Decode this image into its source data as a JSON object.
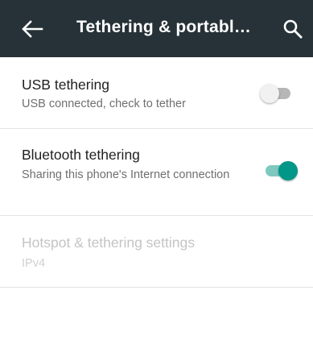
{
  "appbar": {
    "back_icon": "arrow-back-icon",
    "title": "Tethering & portabl…",
    "search_icon": "search-icon",
    "background_color": "#263238"
  },
  "settings": [
    {
      "title": "USB tethering",
      "summary": "USB connected, check to tether",
      "switch_on": false,
      "enabled": true
    },
    {
      "title": "Bluetooth tethering",
      "summary": "Sharing this phone's Internet connection",
      "switch_on": true,
      "enabled": true
    },
    {
      "title": "Hotspot & tethering settings",
      "summary": "IPv4",
      "enabled": false
    }
  ],
  "colors": {
    "accent": "#009688",
    "accent_track": "#7fc8bf"
  }
}
